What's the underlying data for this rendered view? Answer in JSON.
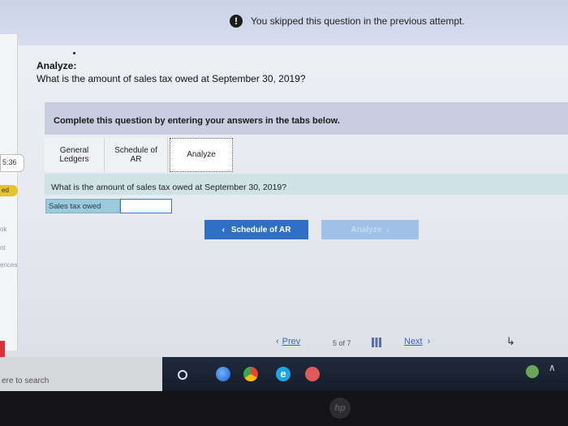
{
  "banner": {
    "icon": "alert-icon",
    "text": "You skipped this question in the previous attempt."
  },
  "sidebar": {
    "time": "5:36",
    "badge": "ed",
    "words": [
      "ok",
      "nt",
      "ences"
    ]
  },
  "prompt": {
    "heading": "Analyze:",
    "question": "What is the amount of sales tax owed at September 30, 2019?"
  },
  "instructions": "Complete this question by entering your answers in the tabs below.",
  "tabs": [
    {
      "label": "General Ledgers"
    },
    {
      "label": "Schedule of AR"
    },
    {
      "label": "Analyze",
      "active": true
    }
  ],
  "tab_question": "What is the amount of sales tax owed at September 30, 2019?",
  "answer": {
    "label": "Sales tax owed",
    "value": ""
  },
  "nav_buttons": {
    "prev_tab": "Schedule of AR",
    "next_tab": "Analyze"
  },
  "pager": {
    "prev": "Prev",
    "count": "5 of 7",
    "next": "Next"
  },
  "taskbar": {
    "search_placeholder": "ere to search"
  },
  "colors": {
    "primary": "#2f70c6",
    "instructions_bg": "#c9cde0",
    "question_bg": "#cfe3e6"
  }
}
